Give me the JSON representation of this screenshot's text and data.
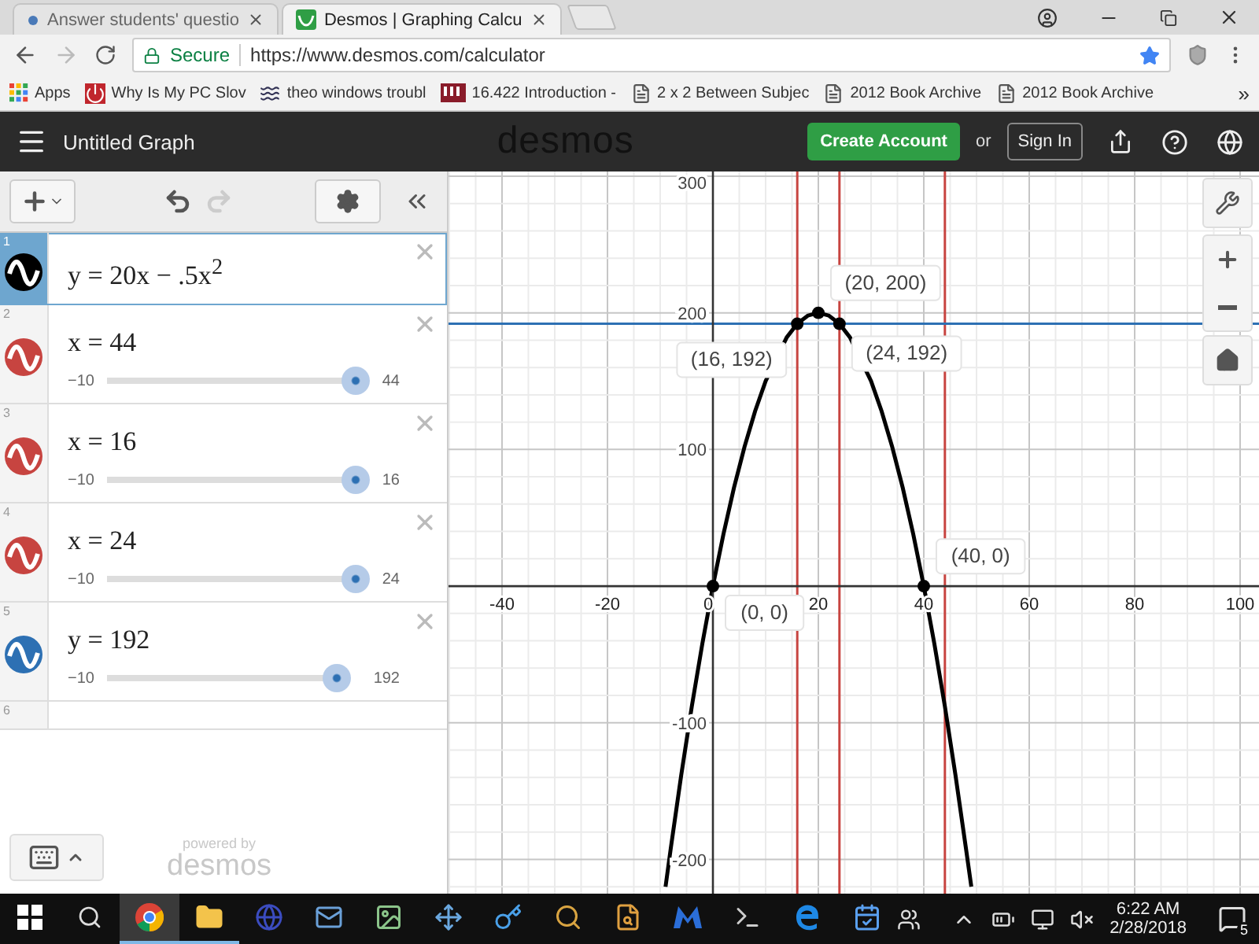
{
  "browser": {
    "tabs": [
      {
        "title": "Answer students' questio",
        "kind": "page",
        "selected": false
      },
      {
        "title": "Desmos | Graphing Calcu",
        "kind": "desmos",
        "selected": true
      }
    ],
    "address": {
      "secure_label": "Secure",
      "url": "https://www.desmos.com/calculator"
    },
    "bookmarks": [
      {
        "label": "Apps",
        "kind": "apps"
      },
      {
        "label": "Why Is My PC Slov",
        "kind": "power"
      },
      {
        "label": "theo windows troubl",
        "kind": "squiggle"
      },
      {
        "label": "16.422 Introduction -",
        "kind": "mit"
      },
      {
        "label": "2 x 2 Between Subjec",
        "kind": "doc"
      },
      {
        "label": "2012 Book Archive",
        "kind": "doc"
      },
      {
        "label": "2012 Book Archive",
        "kind": "doc"
      }
    ],
    "bookmarks_overflow": "»"
  },
  "header": {
    "title": "Untitled Graph",
    "logo": "desmos",
    "create_account": "Create Account",
    "or": "or",
    "sign_in": "Sign In"
  },
  "expressions": [
    {
      "index": "1",
      "kind": "curve",
      "latex": "y = 20x − .5x$^{2}$",
      "color": "#000000",
      "selected": true
    },
    {
      "index": "2",
      "kind": "slider",
      "latex": "x = 44",
      "color": "#c74440",
      "selected": false,
      "slider": {
        "min": "−10",
        "max": "44",
        "level": 1
      }
    },
    {
      "index": "3",
      "kind": "slider",
      "latex": "x = 16",
      "color": "#c74440",
      "selected": false,
      "slider": {
        "min": "−10",
        "max": "16",
        "level": 1
      }
    },
    {
      "index": "4",
      "kind": "slider",
      "latex": "x = 24",
      "color": "#c74440",
      "selected": false,
      "slider": {
        "min": "−10",
        "max": "24",
        "level": 1
      }
    },
    {
      "index": "5",
      "kind": "slider",
      "latex": "y = 192",
      "color": "#2d70b3",
      "selected": false,
      "slider": {
        "min": "−10",
        "max": "192",
        "level": 0.96
      }
    },
    {
      "index": "6",
      "kind": "empty",
      "selected": false
    }
  ],
  "footer": {
    "powered_by": "powered by",
    "brand": "desmos"
  },
  "graph": {
    "chart_data": {
      "type": "line",
      "x": [
        -9,
        -8,
        -6,
        -4,
        -2,
        0,
        2,
        4,
        6,
        8,
        10,
        14,
        16,
        18,
        20,
        22,
        24,
        26,
        30,
        32,
        34,
        36,
        38,
        40,
        42,
        44,
        46,
        48,
        49
      ],
      "series": [
        {
          "color": "#000000",
          "values": [
            -220,
            -192,
            -138,
            -88,
            -42,
            0,
            38,
            72,
            102,
            128,
            150,
            182,
            192,
            198,
            200,
            198,
            192,
            182,
            150,
            128,
            102,
            72,
            38,
            0,
            -42,
            -88,
            -138,
            -192,
            -220
          ]
        }
      ],
      "grid": true,
      "xlim": [
        -50.15,
        103.58
      ],
      "ylim": [
        -225,
        303.4
      ],
      "xticks": [
        -40,
        -20,
        0,
        20,
        40,
        60,
        80,
        100
      ],
      "yticks": [
        -200,
        -100,
        100,
        200,
        300
      ],
      "ref_lines": [
        {
          "axis": "x",
          "value": 44,
          "color": "#c74440"
        },
        {
          "axis": "x",
          "value": 16,
          "color": "#c74440"
        },
        {
          "axis": "x",
          "value": 24,
          "color": "#c74440"
        },
        {
          "axis": "y",
          "value": 192,
          "color": "#2d70b3"
        }
      ],
      "annotations": [
        {
          "x": 20,
          "y": 200,
          "text": "(20, 200)"
        },
        {
          "x": 16,
          "y": 192,
          "text": "(16, 192)"
        },
        {
          "x": 24,
          "y": 192,
          "text": "(24, 192)"
        },
        {
          "x": 40,
          "y": 0,
          "text": "(40, 0)"
        },
        {
          "x": 0,
          "y": 0,
          "text": "(0, 0)"
        }
      ]
    }
  },
  "taskbar": {
    "apps": [
      {
        "kind": "chrome",
        "open": true,
        "selected": true
      },
      {
        "kind": "folder",
        "open": true,
        "selected": false
      },
      {
        "kind": "globe",
        "open": false,
        "selected": false
      },
      {
        "kind": "mail",
        "open": false,
        "selected": false
      },
      {
        "kind": "image",
        "open": false,
        "selected": false
      },
      {
        "kind": "arrows",
        "open": false,
        "selected": false
      },
      {
        "kind": "key",
        "open": false,
        "selected": false
      },
      {
        "kind": "magnifier",
        "open": false,
        "selected": false
      },
      {
        "kind": "document",
        "open": false,
        "selected": false
      },
      {
        "kind": "m-logo",
        "open": false,
        "selected": false
      },
      {
        "kind": "terminal",
        "open": false,
        "selected": false
      },
      {
        "kind": "e-logo",
        "open": false,
        "selected": false
      },
      {
        "kind": "calendar",
        "open": false,
        "selected": false
      }
    ],
    "time": "6:22 AM",
    "date": "2/28/2018",
    "notifications": "5"
  }
}
